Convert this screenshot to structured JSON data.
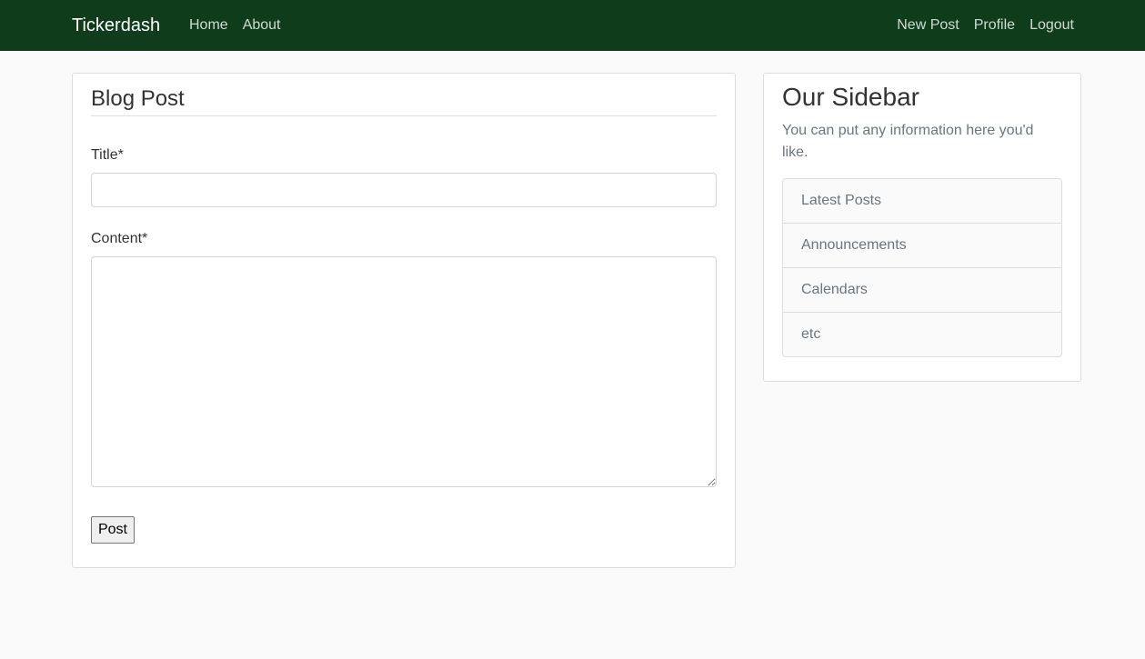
{
  "navbar": {
    "brand": "Tickerdash",
    "left_links": [
      "Home",
      "About"
    ],
    "right_links": [
      "New Post",
      "Profile",
      "Logout"
    ],
    "background": "#0f3d1c"
  },
  "form": {
    "heading": "Blog Post",
    "title_label": "Title*",
    "title_value": "",
    "content_label": "Content*",
    "content_value": "",
    "submit_label": "Post"
  },
  "sidebar": {
    "title": "Our Sidebar",
    "description": "You can put any information here you'd like.",
    "items": [
      "Latest Posts",
      "Announcements",
      "Calendars",
      "etc"
    ]
  }
}
